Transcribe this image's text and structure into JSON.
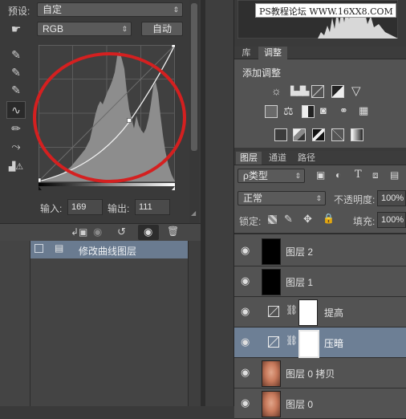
{
  "properties": {
    "preset_label": "预设:",
    "preset_value": "自定",
    "channel_value": "RGB",
    "auto_button": "自动",
    "input_label": "输入:",
    "input_value": "169",
    "output_label": "输出:",
    "output_value": "111"
  },
  "history": {
    "item_label": "修改曲线图层"
  },
  "watermark": "PS教程论坛 WWW.16XX8.COM",
  "adjustments": {
    "tabs": [
      "库",
      "调整"
    ],
    "title": "添加调整"
  },
  "layers_panel": {
    "tabs": [
      "图层",
      "通道",
      "路径"
    ],
    "filter_label": "ρ类型",
    "blend_mode": "正常",
    "opacity_label": "不透明度:",
    "opacity_value": "100%",
    "lock_label": "锁定:",
    "fill_label": "填充:",
    "fill_value": "100%",
    "layers": [
      {
        "name": "图层 2"
      },
      {
        "name": "图层 1"
      },
      {
        "name": "提高"
      },
      {
        "name": "压暗"
      },
      {
        "name": "图层 0 拷贝"
      },
      {
        "name": "图层 0"
      }
    ]
  },
  "chart_data": {
    "type": "line",
    "title": "",
    "xlabel": "",
    "ylabel": "",
    "xlim": [
      0,
      255
    ],
    "ylim": [
      0,
      255
    ],
    "control_points": [
      [
        0,
        0
      ],
      [
        169,
        111
      ],
      [
        255,
        255
      ]
    ],
    "histogram_peaks": [
      [
        95,
        200
      ],
      [
        125,
        175
      ],
      [
        145,
        95
      ],
      [
        180,
        120
      ]
    ]
  },
  "colors": {
    "panel_bg": "#3a3a3a",
    "selected_layer": "#6d7f95",
    "annotation_circle": "#d42020"
  }
}
